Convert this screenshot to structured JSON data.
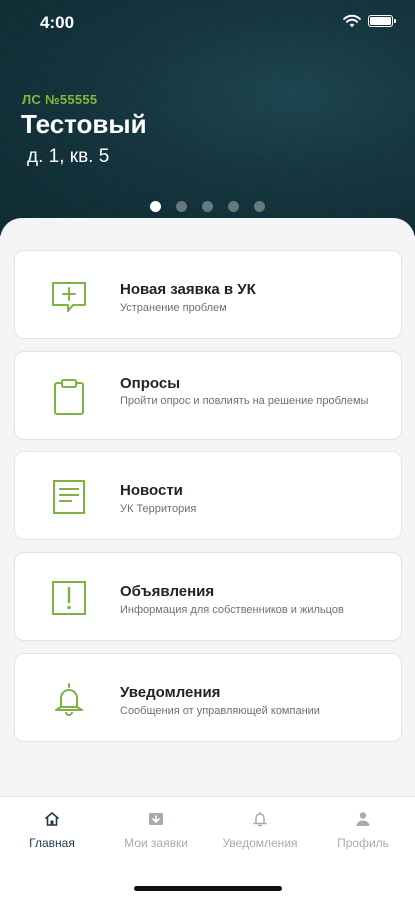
{
  "status_bar": {
    "time": "4:00"
  },
  "hero": {
    "account": "ЛС №55555",
    "name": "Тестовый",
    "address": "д. 1, кв. 5",
    "page_count": 5,
    "active_page": 1
  },
  "cards": [
    {
      "title": "Новая заявка в УК",
      "subtitle": "Устранение проблем",
      "icon": "new-request-icon"
    },
    {
      "title": "Опросы",
      "subtitle": "Пройти опрос и повлиять на решение проблемы",
      "icon": "clipboard-icon"
    },
    {
      "title": "Новости",
      "subtitle": "УК Территория",
      "icon": "document-icon"
    },
    {
      "title": "Объявления",
      "subtitle": "Информация для собственников и жильцов",
      "icon": "exclamation-icon"
    },
    {
      "title": "Уведомления",
      "subtitle": "Сообщения от управляющей компании",
      "icon": "bell-icon"
    }
  ],
  "tabbar": {
    "items": [
      {
        "label": "Главная",
        "icon": "home-icon",
        "active": true
      },
      {
        "label": "Мои заявки",
        "icon": "requests-icon",
        "active": false
      },
      {
        "label": "Уведомления",
        "icon": "bell-icon",
        "active": false
      },
      {
        "label": "Профиль",
        "icon": "person-icon",
        "active": false
      }
    ]
  },
  "colors": {
    "accent_green": "#8ab63b",
    "icon_green": "#7cb342",
    "hero_bg": "#15343d",
    "tab_active": "#1e3a47",
    "tab_inactive": "#a6abb3"
  }
}
